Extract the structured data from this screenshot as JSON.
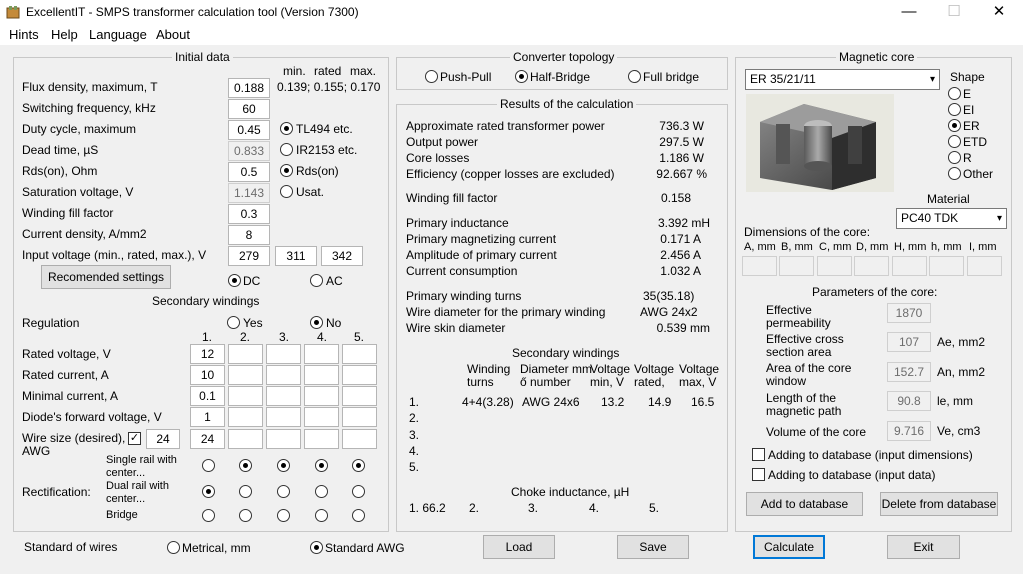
{
  "window": {
    "title": "ExcellentIT - SMPS transformer calculation tool (Version 7300)",
    "minimize": "—",
    "maximize": "☐",
    "close": "✕"
  },
  "menu": [
    "Hints",
    "Help",
    "Language",
    "About"
  ],
  "initial": {
    "title": "Initial data",
    "col_min": "min.",
    "col_rated": "rated",
    "col_max": "max.",
    "flux_label": "Flux density, maximum, T",
    "flux_value": "0.188",
    "flux_hint": "0.139; 0.155; 0.170",
    "freq_label": "Switching frequency, kHz",
    "freq_value": "60",
    "duty_label": "Duty cycle, maximum",
    "duty_value": "0.45",
    "dead_label": "Dead time, µS",
    "dead_value": "0.833",
    "rds_label": "Rds(on), Ohm",
    "rds_value": "0.5",
    "sat_label": "Saturation voltage, V",
    "sat_value": "1.143",
    "fill_label": "Winding fill factor",
    "fill_value": "0.3",
    "current_label": "Current density, A/mm2",
    "current_value": "8",
    "input_label": "Input voltage (min., rated, max.), V",
    "input_min": "279",
    "input_rated": "311",
    "input_max": "342",
    "opt_tl494": "TL494 etc.",
    "opt_ir2153": "IR2153 etc.",
    "opt_rds": "Rds(on)",
    "opt_usat": "Usat.",
    "recommended_button": "Recomended settings",
    "dc": "DC",
    "ac": "AC"
  },
  "secondary": {
    "title": "Secondary windings",
    "regulation_label": "Regulation",
    "yes": "Yes",
    "no": "No",
    "cols": [
      "1.",
      "2.",
      "3.",
      "4.",
      "5."
    ],
    "rated_voltage_label": "Rated voltage, V",
    "rated_voltage": [
      "12",
      "",
      "",
      "",
      ""
    ],
    "rated_current_label": "Rated current, A",
    "rated_current": [
      "10",
      "",
      "",
      "",
      ""
    ],
    "min_current_label": "Minimal current, A",
    "min_current": [
      "0.1",
      "",
      "",
      "",
      ""
    ],
    "diode_label": "Diode's forward voltage, V",
    "diode": [
      "1",
      "",
      "",
      "",
      ""
    ],
    "wire_label_1": "Wire size (desired),",
    "wire_label_2": "AWG",
    "wire_check": "✓",
    "wire_default": "24",
    "wire": [
      "24",
      "",
      "",
      "",
      ""
    ],
    "rect_label": "Rectification:",
    "single_1": "Single rail with",
    "single_2": "center...",
    "dual_1": "Dual rail with",
    "dual_2": "center...",
    "bridge": "Bridge"
  },
  "bottom": {
    "standard_label": "Standard of wires",
    "metrical": "Metrical, mm",
    "awg": "Standard AWG",
    "load": "Load",
    "save": "Save",
    "calculate": "Calculate",
    "exit": "Exit"
  },
  "topology": {
    "title": "Converter topology",
    "push_pull": "Push-Pull",
    "half_bridge": "Half-Bridge",
    "full_bridge": "Full bridge"
  },
  "results": {
    "title": "Results of the calculation",
    "rows": [
      {
        "label": "Approximate rated transformer power",
        "value": "736.3 W"
      },
      {
        "label": "Output power",
        "value": "297.5 W"
      },
      {
        "label": "Core losses",
        "value": "1.186 W"
      },
      {
        "label": "Efficiency (copper losses are excluded)",
        "value": "92.667 %"
      },
      {
        "label": "Winding fill factor",
        "value": "0.158"
      },
      {
        "label": "Primary inductance",
        "value": "3.392 mH"
      },
      {
        "label": "Primary magnetizing current",
        "value": "0.171 A"
      },
      {
        "label": "Amplitude of primary current",
        "value": "2.456 A"
      },
      {
        "label": "Current consumption",
        "value": "1.032 A"
      },
      {
        "label": "Primary winding turns",
        "value": "35(35.18)"
      },
      {
        "label": "Wire diameter for the primary winding",
        "value": "AWG 24x2"
      },
      {
        "label": "Wire skin diameter",
        "value": "0.539 mm"
      }
    ],
    "sec_title": "Secondary windings",
    "sec_h_turns_1": "Winding",
    "sec_h_turns_2": "turns",
    "sec_h_diam_1": "Diameter mm",
    "sec_h_diam_2": "ő number",
    "sec_h_vmin_1": "Voltage",
    "sec_h_vmin_2": "min, V",
    "sec_h_vrated_1": "Voltage",
    "sec_h_vrated_2": "rated,",
    "sec_h_vmax_1": "Voltage",
    "sec_h_vmax_2": "max, V",
    "sec_rows": [
      {
        "n": "1.",
        "turns": "4+4(3.28)",
        "diam": "AWG 24x6",
        "vmin": "13.2",
        "vrated": "14.9",
        "vmax": "16.5"
      },
      {
        "n": "2.",
        "turns": "",
        "diam": "",
        "vmin": "",
        "vrated": "",
        "vmax": ""
      },
      {
        "n": "3.",
        "turns": "",
        "diam": "",
        "vmin": "",
        "vrated": "",
        "vmax": ""
      },
      {
        "n": "4.",
        "turns": "",
        "diam": "",
        "vmin": "",
        "vrated": "",
        "vmax": ""
      },
      {
        "n": "5.",
        "turns": "",
        "diam": "",
        "vmin": "",
        "vrated": "",
        "vmax": ""
      }
    ],
    "choke_title": "Choke inductance, µH",
    "choke": [
      "1. 66.2",
      "2.",
      "3.",
      "4.",
      "5."
    ]
  },
  "core": {
    "title": "Magnetic core",
    "selected": "ER 35/21/11",
    "shape_title": "Shape",
    "shapes": [
      "E",
      "EI",
      "ER",
      "ETD",
      "R",
      "Other"
    ],
    "material_title": "Material",
    "material": "PC40 TDK",
    "dims_title": "Dimensions of the core:",
    "dims": [
      "A, mm",
      "B, mm",
      "C, mm",
      "D, mm",
      "H, mm",
      "h, mm",
      "I, mm"
    ],
    "params_title": "Parameters of the core:",
    "perm_1": "Effective",
    "perm_2": "permeability",
    "perm_value": "1870",
    "cross_1": "Effective cross",
    "cross_2": "section area",
    "cross_value": "107",
    "cross_unit": "Ae, mm2",
    "window_1": "Area of the core",
    "window_2": "window",
    "window_value": "152.7",
    "window_unit": "An, mm2",
    "path_1": "Length of the",
    "path_2": "magnetic path",
    "path_value": "90.8",
    "path_unit": "le, mm",
    "volume_label": "Volume of the core",
    "volume_value": "9.716",
    "volume_unit": "Ve, cm3",
    "add_dims": "Adding to database (input dimensions)",
    "add_data": "Adding to database (input data)",
    "add_button": "Add to database",
    "delete_button": "Delete from database"
  }
}
